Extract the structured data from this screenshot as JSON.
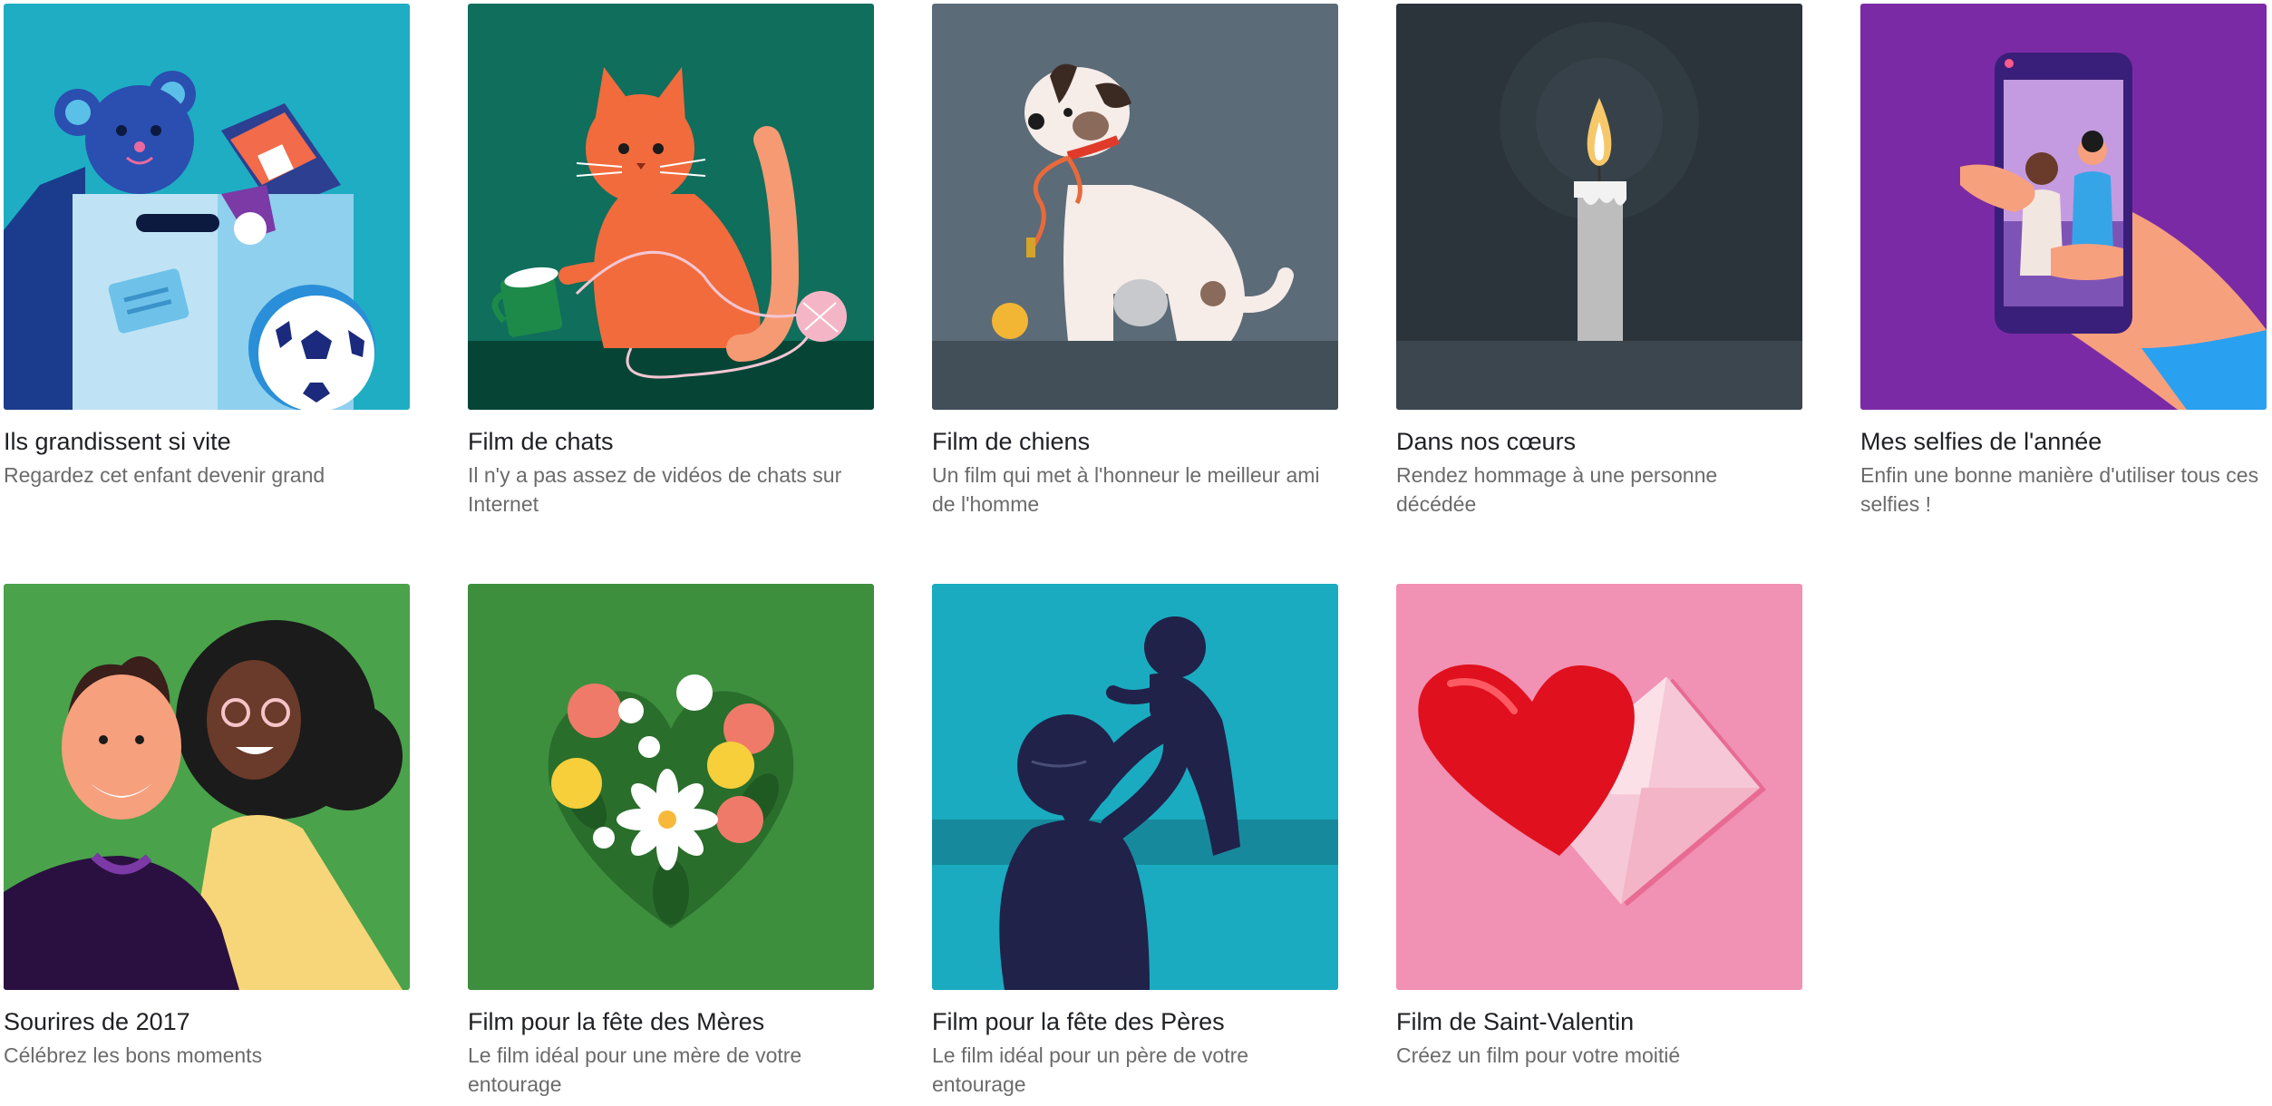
{
  "cards": [
    {
      "title": "Ils grandissent si vite",
      "description": "Regardez cet enfant devenir grand",
      "illustration": "teddy-bear-toy-box-illustration",
      "color": "#1fadc3"
    },
    {
      "title": "Film de chats",
      "description": "Il n'y a pas assez de vidéos de chats sur Internet",
      "illustration": "cat-with-yarn-illustration",
      "color": "#0f6e5c"
    },
    {
      "title": "Film de chiens",
      "description": "Un film qui met à l'honneur le meilleur ami de l'homme",
      "illustration": "dog-with-leash-illustration",
      "color": "#5b6b78"
    },
    {
      "title": "Dans nos cœurs",
      "description": "Rendez hommage à une personne décédée",
      "illustration": "candle-illustration",
      "color": "#2b343b"
    },
    {
      "title": "Mes selfies de l'année",
      "description": "Enfin une bonne manière d'utiliser tous ces selfies !",
      "illustration": "selfie-phone-illustration",
      "color": "#7b2aa6"
    },
    {
      "title": "Sourires de 2017",
      "description": "Célébrez les bons moments",
      "illustration": "smiling-couple-illustration",
      "color": "#4aa24a"
    },
    {
      "title": "Film pour la fête des Mères",
      "description": "Le film idéal pour une mère de votre entourage",
      "illustration": "flower-heart-illustration",
      "color": "#3d8f3e"
    },
    {
      "title": "Film pour la fête des Pères",
      "description": "Le film idéal pour un père de votre entourage",
      "illustration": "father-lifting-baby-illustration",
      "color": "#1aabc0"
    },
    {
      "title": "Film de Saint-Valentin",
      "description": "Créez un film pour votre moitié",
      "illustration": "heart-envelope-illustration",
      "color": "#f191b4"
    }
  ]
}
